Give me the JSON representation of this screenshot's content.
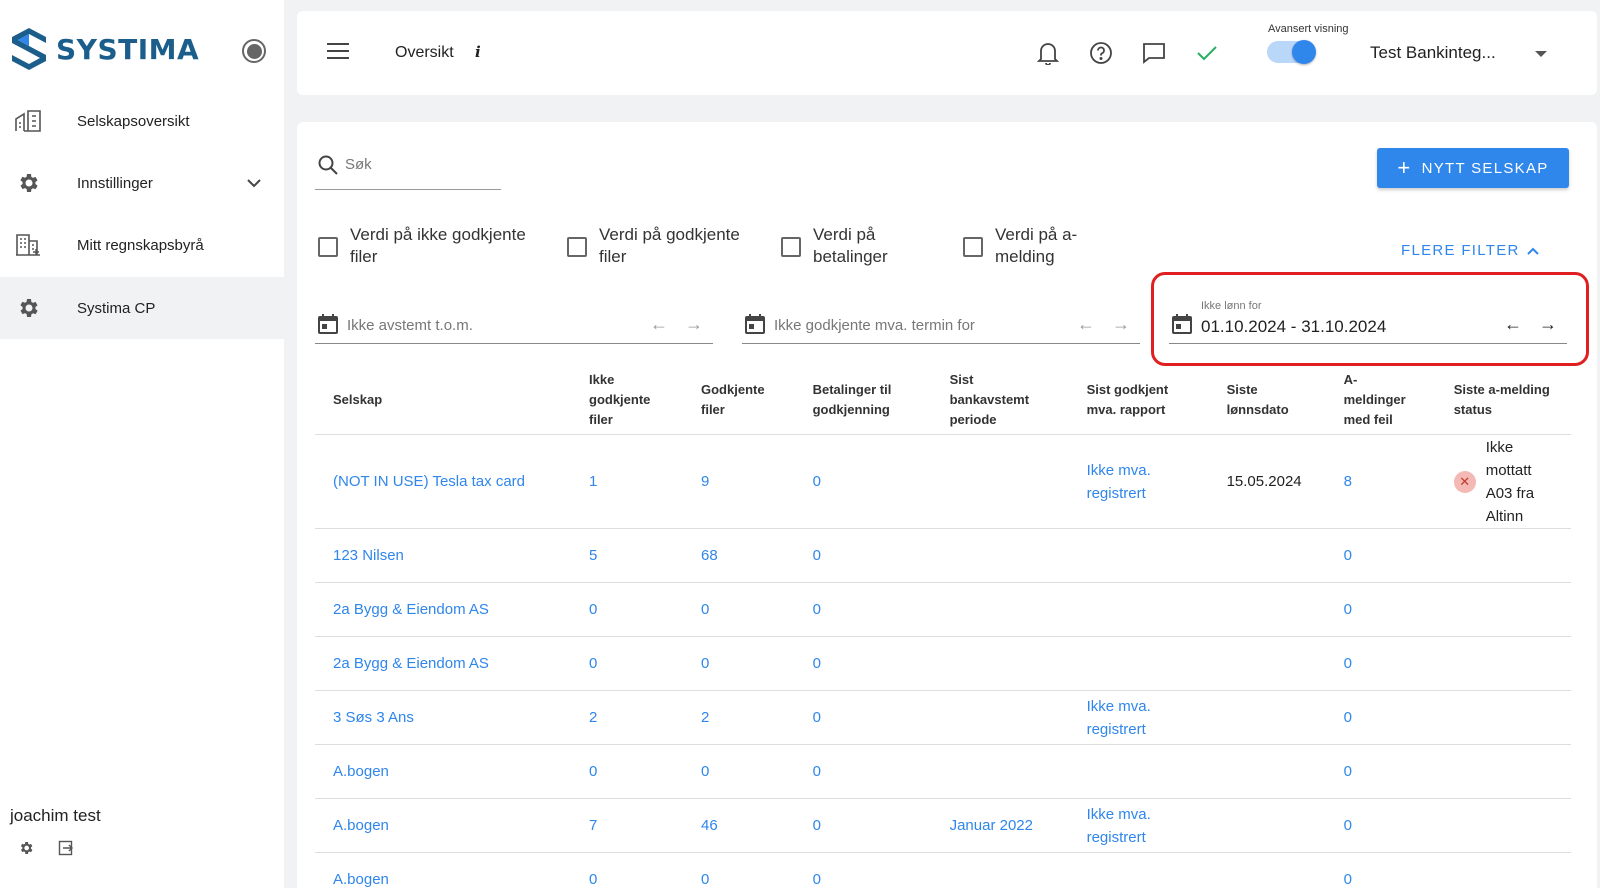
{
  "sidebar": {
    "logo_text": "SYSTIMA",
    "items": [
      {
        "label": "Selskapsoversikt",
        "icon": "building-icon"
      },
      {
        "label": "Innstillinger",
        "icon": "gear-icon"
      },
      {
        "label": "Mitt regnskapsbyrå",
        "icon": "office-building-icon"
      },
      {
        "label": "Systima CP",
        "icon": "gear-icon"
      }
    ],
    "user_name": "joachim test"
  },
  "header": {
    "title": "Oversikt",
    "info": "i",
    "advanced_label": "Avansert visning",
    "company": "Test Bankinteg..."
  },
  "main": {
    "search_placeholder": "Søk",
    "new_company_label": "NYTT SELSKAP",
    "checkboxes": [
      "Verdi på ikke godkjente filer",
      "Verdi på godkjente filer",
      "Verdi på betalinger",
      "Verdi på a-melding"
    ],
    "more_filters": "FLERE FILTER",
    "date_filters": [
      {
        "placeholder": "Ikke avstemt t.o.m."
      },
      {
        "placeholder": "Ikke godkjente mva. termin for"
      },
      {
        "label": "Ikke lønn for",
        "value": "01.10.2024 - 31.10.2024"
      }
    ]
  },
  "table": {
    "columns": [
      "Selskap",
      "Ikke godkjente filer",
      "Godkjente filer",
      "Betalinger til godkjenning",
      "Sist bankavstemt periode",
      "Sist godkjent mva. rapport",
      "Siste lønnsdato",
      "A-meldinger med feil",
      "Siste a-melding status"
    ],
    "rows": [
      {
        "company": "(NOT IN USE) Tesla tax card",
        "unapproved": "1",
        "approved": "9",
        "payments": "0",
        "bank": "",
        "vat": "Ikke mva. registrert",
        "salary": "15.05.2024",
        "errors": "8",
        "status": "Ikke mottatt A03 fra Altinn"
      },
      {
        "company": "123 Nilsen",
        "unapproved": "5",
        "approved": "68",
        "payments": "0",
        "bank": "",
        "vat": "",
        "salary": "",
        "errors": "0",
        "status": ""
      },
      {
        "company": "2a Bygg & Eiendom AS",
        "unapproved": "0",
        "approved": "0",
        "payments": "0",
        "bank": "",
        "vat": "",
        "salary": "",
        "errors": "0",
        "status": ""
      },
      {
        "company": "2a Bygg & Eiendom AS",
        "unapproved": "0",
        "approved": "0",
        "payments": "0",
        "bank": "",
        "vat": "",
        "salary": "",
        "errors": "0",
        "status": ""
      },
      {
        "company": "3 Søs 3 Ans",
        "unapproved": "2",
        "approved": "2",
        "payments": "0",
        "bank": "",
        "vat": "Ikke mva. registrert",
        "salary": "",
        "errors": "0",
        "status": ""
      },
      {
        "company": "A.bogen",
        "unapproved": "0",
        "approved": "0",
        "payments": "0",
        "bank": "",
        "vat": "",
        "salary": "",
        "errors": "0",
        "status": ""
      },
      {
        "company": "A.bogen",
        "unapproved": "7",
        "approved": "46",
        "payments": "0",
        "bank": "Januar 2022",
        "vat": "Ikke mva. registrert",
        "salary": "",
        "errors": "0",
        "status": ""
      },
      {
        "company": "A.bogen",
        "unapproved": "0",
        "approved": "0",
        "payments": "0",
        "bank": "",
        "vat": "",
        "salary": "",
        "errors": "0",
        "status": ""
      }
    ]
  },
  "colors": {
    "accent": "#2f86eb",
    "brand": "#1b5e8c",
    "highlight": "#e02020"
  }
}
